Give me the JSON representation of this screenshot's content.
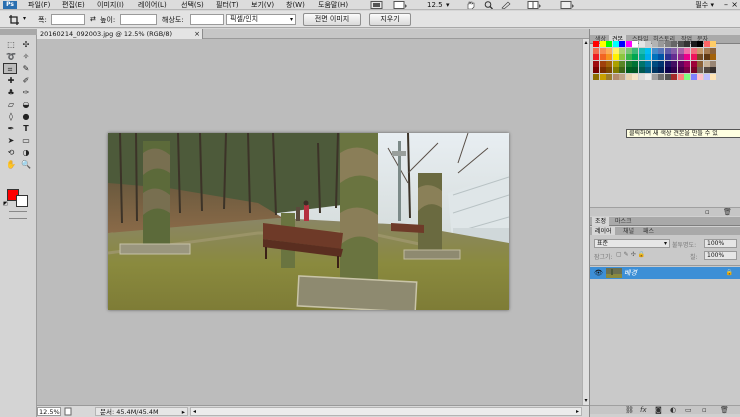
{
  "app": {
    "logo": "Ps"
  },
  "menu": [
    {
      "label": "파일(F)"
    },
    {
      "label": "편집(E)"
    },
    {
      "label": "이미지(I)"
    },
    {
      "label": "레이어(L)"
    },
    {
      "label": "선택(S)"
    },
    {
      "label": "필터(T)"
    },
    {
      "label": "보기(V)"
    },
    {
      "label": "창(W)"
    },
    {
      "label": "도움말(H)"
    }
  ],
  "menubar_tools": {
    "zoom_value": "12.5",
    "zoom_arrow": "▾",
    "workspace": "필수"
  },
  "options": {
    "width_label": "폭:",
    "swap_icon": "⇄",
    "height_label": "높이:",
    "resolution_label": "해상도:",
    "unit_value": "픽셀/인치",
    "front_image_button": "전면 이미지",
    "clear_button": "지우기"
  },
  "document": {
    "tab_title": "20160214_092003.jpg @ 12.5% (RGB/8)",
    "tab_close": "×",
    "zoom": "12.5%",
    "info": "문서: 45.4M/45.4M",
    "info_arrow": "▸",
    "h_scroll_left": "◂",
    "h_scroll_right": "▸",
    "v_scroll_up": "▴",
    "v_scroll_down": "▾"
  },
  "colors": {
    "foreground": "#ff0000",
    "background": "#ffffff",
    "selected_layer": "#3d8fd6"
  },
  "swatches_panel": {
    "tabs": [
      "색상",
      "견본",
      "스타일",
      "히스토리",
      "작업",
      "문자"
    ],
    "tooltip": "클릭하여 새 색상 견본을 만들 수 있",
    "swatches": [
      "#ff0000",
      "#ffff00",
      "#00ff00",
      "#00ffff",
      "#0000ff",
      "#ff00ff",
      "#ffffff",
      "#e6e6e6",
      "#cccccc",
      "#b3b3b3",
      "#999999",
      "#808080",
      "#666666",
      "#4d4d4d",
      "#333333",
      "#1a1a1a",
      "#000000",
      "#ff6666",
      "#ffcc66",
      "#f26c4f",
      "#f68e55",
      "#fbaf5c",
      "#fff467",
      "#acd372",
      "#7cc576",
      "#3bb878",
      "#1abbb4",
      "#00bff3",
      "#438ccb",
      "#5574b9",
      "#605ca8",
      "#855fa8",
      "#a763a8",
      "#f06ea9",
      "#f26d7d",
      "#c69c6d",
      "#a67c52",
      "#8c6239",
      "#ed1c24",
      "#f26522",
      "#f7941d",
      "#fff200",
      "#8dc63f",
      "#39b54a",
      "#00a651",
      "#00a99d",
      "#00aeef",
      "#0072bc",
      "#0054a6",
      "#2e3192",
      "#662d91",
      "#92278f",
      "#ec008c",
      "#ed145b",
      "#754c24",
      "#603913",
      "#a36209",
      "#9e0b0f",
      "#a0410d",
      "#a3620a",
      "#aba000",
      "#598527",
      "#1a7b30",
      "#007236",
      "#00746b",
      "#0076a3",
      "#004b80",
      "#003471",
      "#1b1464",
      "#440e62",
      "#630460",
      "#9e005d",
      "#9e0039",
      "#8c6239",
      "#c7b299",
      "#998675",
      "#790000",
      "#7b2e00",
      "#7d4900",
      "#827b00",
      "#406618",
      "#005e20",
      "#005826",
      "#005952",
      "#005b7f",
      "#003663",
      "#002157",
      "#0d004c",
      "#32004b",
      "#4b0049",
      "#7b0046",
      "#7a0026",
      "#736357",
      "#534741",
      "#362f2d",
      "#8d6e00",
      "#c8a000",
      "#9c7d2a",
      "#b38b6d",
      "#bfa486",
      "#e8d3b0",
      "#f5e5c7",
      "#dcdcdc",
      "#ececec",
      "#a0a0a0",
      "#707070",
      "#505050",
      "#a52a2a",
      "#ff8080",
      "#80ff80",
      "#8080ff",
      "#ffc0cb",
      "#c0c0ff",
      "#ffe4b5"
    ]
  },
  "layers_panel": {
    "tabs": [
      "조정",
      "마스크"
    ],
    "sub_tabs": [
      "레이어",
      "채널",
      "패스"
    ],
    "blend_mode": "표준",
    "opacity_label": "불투명도:",
    "opacity_value": "100%",
    "lock_label": "잠그기:",
    "fill_label": "칠:",
    "fill_value": "100%",
    "layer_name": "배경",
    "layer_lock": "🔒",
    "eye_icon": "👁"
  },
  "icons": {
    "panel_link": "⛓",
    "panel_fx": "fx",
    "panel_mask": "◙",
    "panel_adjust": "◐",
    "panel_folder": "▭",
    "panel_new": "▫",
    "panel_trash": "🗑"
  }
}
